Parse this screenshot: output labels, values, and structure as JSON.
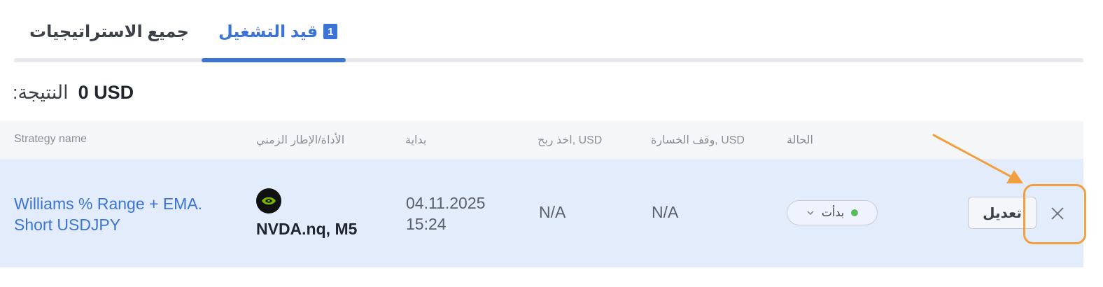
{
  "tabs": {
    "all_label": "جميع الاستراتيجيات",
    "running_label": "قيد التشغيل",
    "running_count": "1"
  },
  "result": {
    "label": "النتيجة:",
    "value": "0 USD"
  },
  "table": {
    "headers": {
      "strategy": "Strategy name",
      "instrument": "الأداة/الإطار الزمني",
      "start": "بداية",
      "take_profit": "اخذ ربح, USD",
      "stop_loss": "وقف الخسارة, USD",
      "status": "الحالة"
    },
    "rows": [
      {
        "strategy": "Williams % Range + EMA. Short USDJPY",
        "instrument": "NVDA.nq, M5",
        "start_date": "04.11.2025",
        "start_time": "15:24",
        "take_profit": "N/A",
        "stop_loss": "N/A",
        "status": "بدأت",
        "edit_label": "تعديل"
      }
    ]
  },
  "icons": {
    "instrument_logo": "nvidia-logo-icon",
    "status_chevron": "chevron-down-icon",
    "close": "close-icon"
  },
  "colors": {
    "accent": "#3b74d6",
    "row_highlight": "#e3ecfb",
    "status_running": "#5cb85c",
    "annotation": "#f0a03e",
    "nvidia_green": "#76b900"
  }
}
